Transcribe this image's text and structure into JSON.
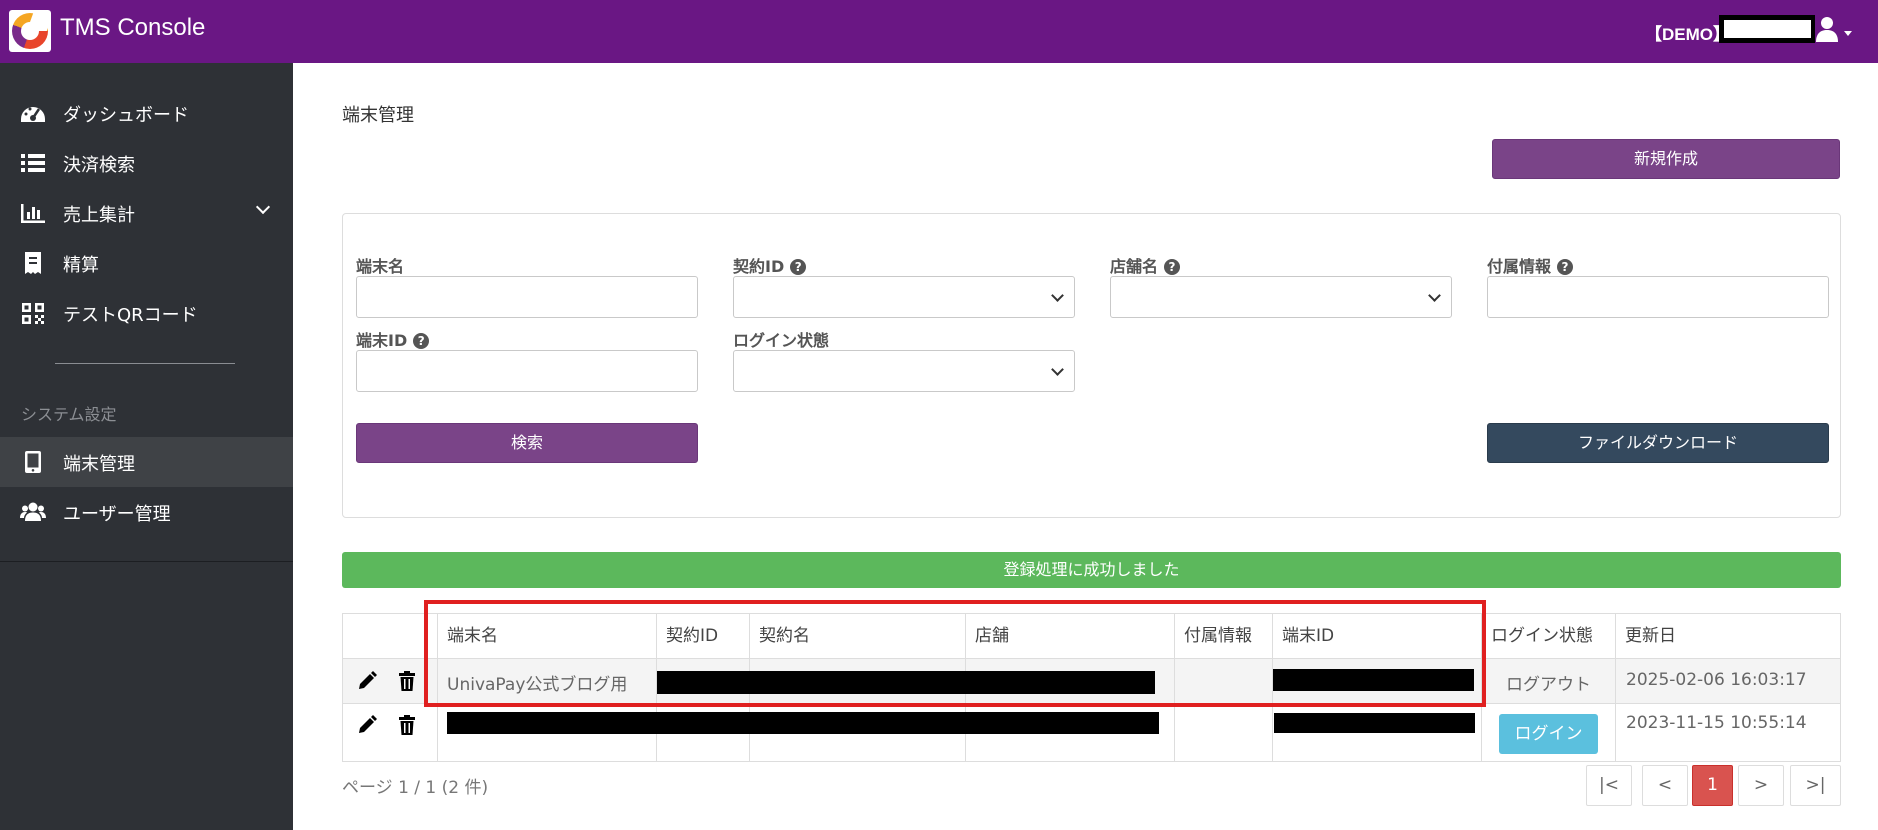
{
  "header": {
    "app_title": "TMS Console",
    "demo_label": "【DEMO】"
  },
  "sidebar": {
    "items": [
      {
        "label": "ダッシュボード",
        "icon": "dashboard-icon"
      },
      {
        "label": "決済検索",
        "icon": "list-icon"
      },
      {
        "label": "売上集計",
        "icon": "bar-chart-icon"
      },
      {
        "label": "精算",
        "icon": "receipt-icon"
      },
      {
        "label": "テストQRコード",
        "icon": "qrcode-icon"
      }
    ],
    "section_label": "システム設定",
    "settings_items": [
      {
        "label": "端末管理",
        "icon": "tablet-icon"
      },
      {
        "label": "ユーザー管理",
        "icon": "users-icon"
      }
    ]
  },
  "main": {
    "page_title": "端末管理",
    "new_button": "新規作成",
    "search": {
      "terminal_name_label": "端末名",
      "contract_id_label": "契約ID",
      "store_name_label": "店舗名",
      "extra_info_label": "付属情報",
      "terminal_id_label": "端末ID",
      "login_state_label": "ログイン状態",
      "search_button": "検索",
      "download_button": "ファイルダウンロード"
    },
    "alert": "登録処理に成功しました",
    "table": {
      "headers": [
        "端末名",
        "契約ID",
        "契約名",
        "店舗",
        "付属情報",
        "端末ID",
        "ログイン状態",
        "更新日"
      ],
      "rows": [
        {
          "terminal_name": "UnivaPay公式ブログ用",
          "login_state": "ログアウト",
          "updated": "2025-02-06 16:03:17"
        },
        {
          "terminal_name": "",
          "login_state": "ログイン",
          "updated": "2023-11-15 10:55:14"
        }
      ]
    },
    "pager": {
      "info": "ページ 1 / 1 (2 件)",
      "first": "|<",
      "prev": "<",
      "current": "1",
      "next": ">",
      "last": ">|"
    }
  },
  "colors": {
    "header_bg": "#6a1784",
    "sidebar_bg": "#2e3136",
    "primary_button": "#7a4488",
    "dark_button": "#34495e",
    "success": "#5cb85c",
    "login_badge": "#5bc0de",
    "pager_active": "#d9534f",
    "highlight_box": "#e02020"
  }
}
